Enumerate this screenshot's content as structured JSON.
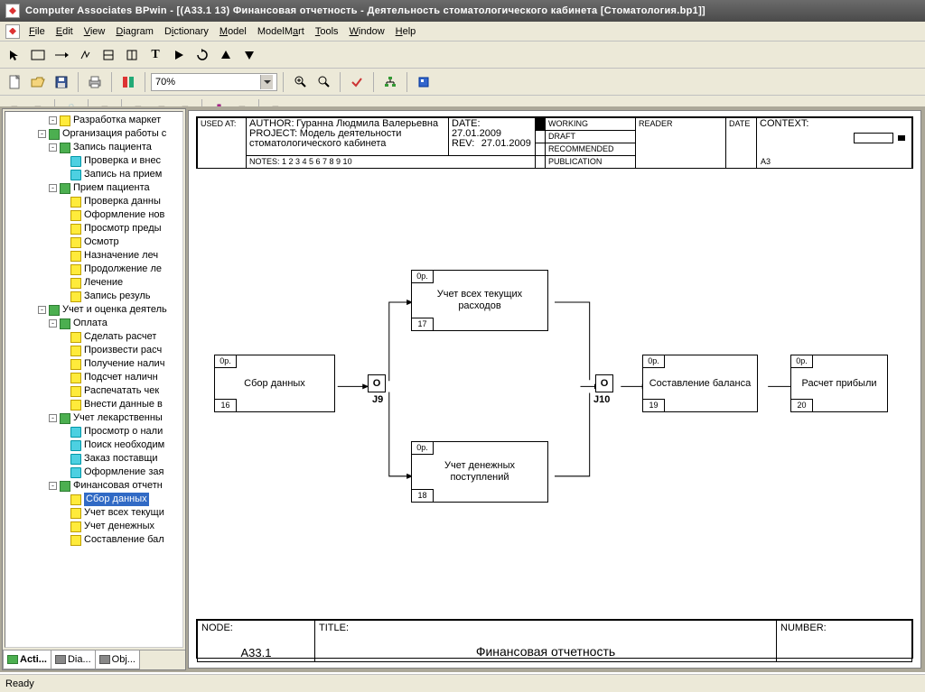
{
  "title": "Computer Associates BPwin - [(A33.1 13) Финансовая отчетность - Деятельность стоматологического кабинета [Стоматология.bp1]]",
  "menus": [
    "File",
    "Edit",
    "View",
    "Diagram",
    "Dictionary",
    "Model",
    "ModelMart",
    "Tools",
    "Window",
    "Help"
  ],
  "zoom": "70%",
  "status": "Ready",
  "tree": [
    {
      "d": 4,
      "t": "-",
      "ic": "yellow",
      "l": "Разработка маркет"
    },
    {
      "d": 3,
      "t": "-",
      "ic": "green",
      "l": "Организация работы с"
    },
    {
      "d": 4,
      "t": "-",
      "ic": "green",
      "l": "Запись пациента"
    },
    {
      "d": 5,
      "t": "",
      "ic": "cyan",
      "l": "Проверка и внес"
    },
    {
      "d": 5,
      "t": "",
      "ic": "cyan",
      "l": "Запись на прием"
    },
    {
      "d": 4,
      "t": "-",
      "ic": "green",
      "l": "Прием пациента"
    },
    {
      "d": 5,
      "t": "",
      "ic": "yellow",
      "l": "Проверка данны"
    },
    {
      "d": 5,
      "t": "",
      "ic": "yellow",
      "l": "Оформление нов"
    },
    {
      "d": 5,
      "t": "",
      "ic": "yellow",
      "l": "Просмотр преды"
    },
    {
      "d": 5,
      "t": "",
      "ic": "yellow",
      "l": "Осмотр"
    },
    {
      "d": 5,
      "t": "",
      "ic": "yellow",
      "l": "Назначение леч"
    },
    {
      "d": 5,
      "t": "",
      "ic": "yellow",
      "l": "Продолжение ле"
    },
    {
      "d": 5,
      "t": "",
      "ic": "yellow",
      "l": "Лечение"
    },
    {
      "d": 5,
      "t": "",
      "ic": "yellow",
      "l": "Запись резуль"
    },
    {
      "d": 3,
      "t": "-",
      "ic": "green",
      "l": "Учет и оценка деятель"
    },
    {
      "d": 4,
      "t": "-",
      "ic": "green",
      "l": "Оплата"
    },
    {
      "d": 5,
      "t": "",
      "ic": "yellow",
      "l": "Сделать расчет"
    },
    {
      "d": 5,
      "t": "",
      "ic": "yellow",
      "l": "Произвести расч"
    },
    {
      "d": 5,
      "t": "",
      "ic": "yellow",
      "l": "Получение налич"
    },
    {
      "d": 5,
      "t": "",
      "ic": "yellow",
      "l": "Подсчет наличн"
    },
    {
      "d": 5,
      "t": "",
      "ic": "yellow",
      "l": "Распечатать чек"
    },
    {
      "d": 5,
      "t": "",
      "ic": "yellow",
      "l": "Внести данные в"
    },
    {
      "d": 4,
      "t": "-",
      "ic": "green",
      "l": "Учет лекарственны"
    },
    {
      "d": 5,
      "t": "",
      "ic": "cyan",
      "l": "Просмотр о нали"
    },
    {
      "d": 5,
      "t": "",
      "ic": "cyan",
      "l": "Поиск необходим"
    },
    {
      "d": 5,
      "t": "",
      "ic": "cyan",
      "l": "Заказ поставщи"
    },
    {
      "d": 5,
      "t": "",
      "ic": "cyan",
      "l": "Оформление зая"
    },
    {
      "d": 4,
      "t": "-",
      "ic": "green",
      "l": "Финансовая отчетн"
    },
    {
      "d": 5,
      "t": "",
      "ic": "yellow",
      "l": "Сбор данных",
      "sel": true
    },
    {
      "d": 5,
      "t": "",
      "ic": "yellow",
      "l": "Учет всех текущи"
    },
    {
      "d": 5,
      "t": "",
      "ic": "yellow",
      "l": "Учет денежных"
    },
    {
      "d": 5,
      "t": "",
      "ic": "yellow",
      "l": "Составление бал"
    }
  ],
  "sidebar_tabs": [
    "Acti...",
    "Dia...",
    "Obj..."
  ],
  "header": {
    "used_at_label": "USED AT:",
    "author_label": "AUTHOR:",
    "author": "Гуранна Людмила Валерьевна",
    "project_label": "PROJECT:",
    "project": "Модель деятельности стоматологического кабинета",
    "notes": "NOTES:  1  2  3  4  5  6  7  8  9  10",
    "date_label": "DATE:",
    "date": "27.01.2009",
    "rev_label": "REV:",
    "rev": "27.01.2009",
    "status": [
      "WORKING",
      "DRAFT",
      "RECOMMENDED",
      "PUBLICATION"
    ],
    "reader_label": "READER",
    "reader_date_label": "DATE",
    "context_label": "CONTEXT:",
    "context_code": "A3"
  },
  "footer": {
    "node_label": "NODE:",
    "node": "A33.1",
    "title_label": "TITLE:",
    "title": "Финансовая отчетность",
    "number_label": "NUMBER:"
  },
  "boxes": {
    "b1": {
      "cap": "0р.",
      "foot": "16",
      "txt": "Сбор данных"
    },
    "b2": {
      "cap": "0р.",
      "foot": "17",
      "txt": "Учет всех текущих расходов"
    },
    "b3": {
      "cap": "0р.",
      "foot": "18",
      "txt": "Учет денежных поступлений"
    },
    "b4": {
      "cap": "0р.",
      "foot": "19",
      "txt": "Составление баланса"
    },
    "b5": {
      "cap": "0р.",
      "foot": "20",
      "txt": "Расчет прибыли"
    }
  },
  "junctions": {
    "j9": {
      "sym": "O",
      "lbl": "J9"
    },
    "j10": {
      "sym": "O",
      "lbl": "J10"
    }
  }
}
